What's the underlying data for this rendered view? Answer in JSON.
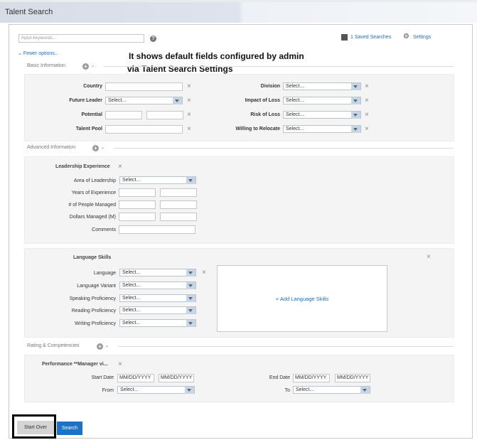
{
  "header": {
    "title": "Talent Search"
  },
  "toolbar": {
    "keywords_placeholder": "Input keywords...",
    "help": "?",
    "saved_searches": "1 Saved Searches",
    "settings": "Settings",
    "fewer_options": "Fewer options..."
  },
  "annotation": {
    "line1": "It shows default fields configured by admin",
    "line2": "via Talent Search Settings"
  },
  "basic": {
    "title": "Basic Information",
    "country": "Country",
    "future_leader": "Future Leader",
    "future_leader_value": "Select...",
    "potential": "Potential",
    "talent_pool": "Talent Pool",
    "division": "Division",
    "division_value": "Select...",
    "impact_of_loss": "Impact of Loss",
    "impact_of_loss_value": "Select...",
    "risk_of_loss": "Risk of Loss",
    "risk_of_loss_value": "Select...",
    "willing_to_relocate": "Willing to Relocate",
    "willing_to_relocate_value": "Select..."
  },
  "advanced": {
    "title": "Advanced Information",
    "leadership_title": "Leadership Experience",
    "area_of_leadership": "Area of Leadership",
    "area_value": "Select...",
    "years_of_experience": "Years of Experience",
    "people_managed": "# of People Managed",
    "dollars_managed": "Dollars Managed (M)",
    "comments": "Comments"
  },
  "language": {
    "title": "Language Skills",
    "language": "Language",
    "language_value": "Select...",
    "variant": "Language Variant",
    "variant_value": "Select...",
    "speaking": "Speaking Proficiency",
    "speaking_value": "Select...",
    "reading": "Reading Proficiency",
    "reading_value": "Select...",
    "writing": "Writing Proficiency",
    "writing_value": "Select...",
    "add_skills": "+ Add Language Skills"
  },
  "ratings": {
    "title": "Rating & Competencies",
    "performance_title": "Performance **Manager vi...",
    "start_date": "Start Date",
    "start_date_placeholder": "MM/DD/YYYY",
    "end_date": "End Date",
    "end_date_placeholder": "MM/DD/YYYY",
    "from": "From",
    "from_value": "Select...",
    "to": "To",
    "to_value": "Select..."
  },
  "actions": {
    "start_over": "Start Over",
    "search": "Search"
  },
  "colors": {
    "accent": "#1a73c9",
    "link": "#2170b8"
  }
}
